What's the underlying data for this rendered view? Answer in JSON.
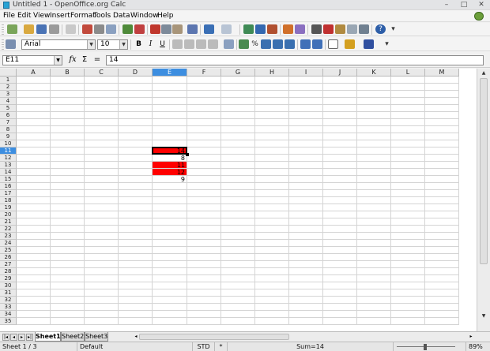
{
  "window": {
    "title": "Untitled 1 - OpenOffice.org Calc"
  },
  "menu": [
    "File",
    "Edit",
    "View",
    "Insert",
    "Format",
    "Tools",
    "Data",
    "Window",
    "Help"
  ],
  "formatting": {
    "font_name": "Arial",
    "font_size": "10"
  },
  "formula_bar": {
    "cell_ref": "E11",
    "function_wizard": "fx",
    "sum_symbol": "Σ",
    "equals_symbol": "=",
    "content": "14"
  },
  "columns": [
    "A",
    "B",
    "C",
    "D",
    "E",
    "F",
    "G",
    "H",
    "I",
    "J",
    "K",
    "L",
    "M"
  ],
  "rows": [
    "1",
    "2",
    "3",
    "4",
    "5",
    "6",
    "7",
    "8",
    "9",
    "10",
    "11",
    "12",
    "13",
    "14",
    "15",
    "16",
    "17",
    "18",
    "19",
    "20",
    "21",
    "22",
    "23",
    "24",
    "25",
    "26",
    "27",
    "28",
    "29",
    "30",
    "31",
    "32",
    "33",
    "34",
    "35"
  ],
  "active_column": "E",
  "active_row": "11",
  "cell_values": {
    "E11": {
      "value": "14",
      "fill": "#ff0000"
    },
    "E12": {
      "value": "8",
      "fill": ""
    },
    "E13": {
      "value": "11",
      "fill": "#ff0000"
    },
    "E14": {
      "value": "12",
      "fill": "#ff0000"
    },
    "E15": {
      "value": "9",
      "fill": ""
    }
  },
  "sheet_tabs": [
    "Sheet1",
    "Sheet2",
    "Sheet3"
  ],
  "active_sheet": "Sheet1",
  "status": {
    "sheet": "Sheet 1 / 3",
    "page_style": "Default",
    "mode": "STD",
    "modified": "*",
    "sum": "Sum=14",
    "zoom": "89%"
  },
  "colors": {
    "highlight": "#ff0000",
    "header_active": "#3d8ee0"
  }
}
